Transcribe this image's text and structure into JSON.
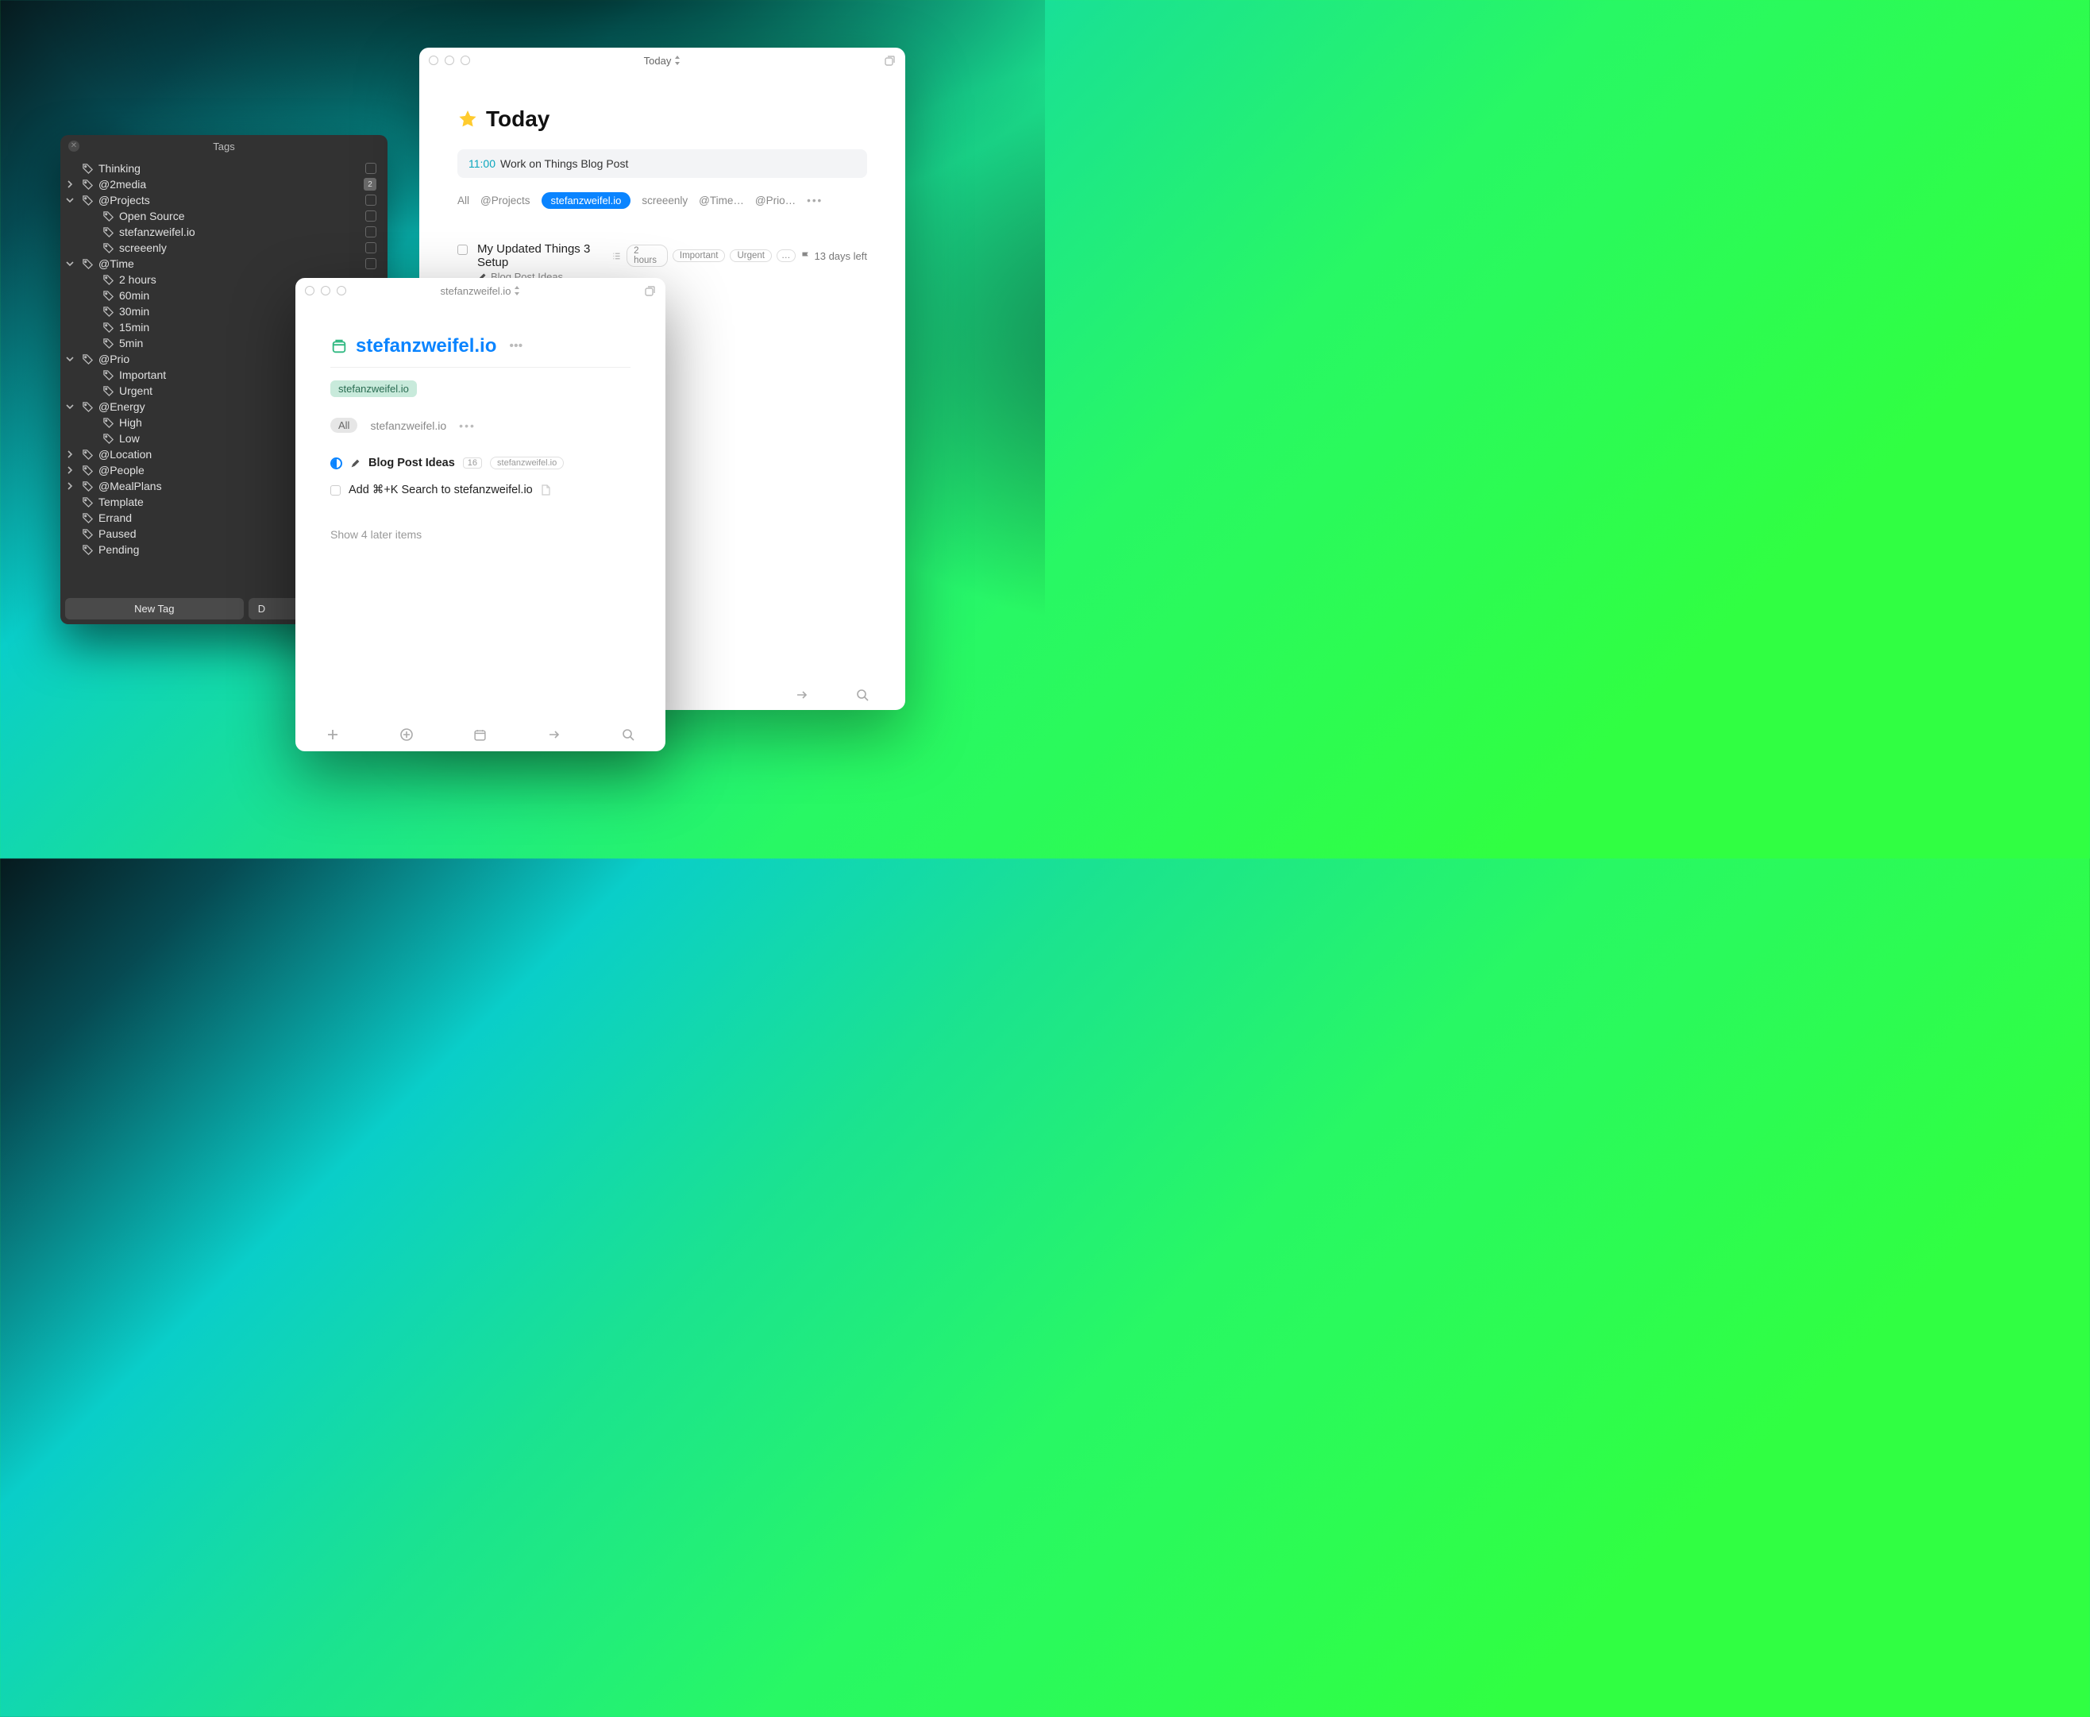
{
  "tags_window": {
    "title": "Tags",
    "new_tag_button": "New Tag",
    "delete_button_visible_text": "D",
    "items": [
      {
        "label": "Thinking",
        "level": 0,
        "chevron": "",
        "right": "checkbox"
      },
      {
        "label": "@2media",
        "level": 0,
        "chevron": "right",
        "right": "count",
        "count": "2"
      },
      {
        "label": "@Projects",
        "level": 0,
        "chevron": "down",
        "right": "checkbox"
      },
      {
        "label": "Open Source",
        "level": 1,
        "chevron": "",
        "right": "checkbox"
      },
      {
        "label": "stefanzweifel.io",
        "level": 1,
        "chevron": "",
        "right": "checkbox"
      },
      {
        "label": "screeenly",
        "level": 1,
        "chevron": "",
        "right": "checkbox"
      },
      {
        "label": "@Time",
        "level": 0,
        "chevron": "down",
        "right": "checkbox"
      },
      {
        "label": "2 hours",
        "level": 1,
        "chevron": "",
        "right": ""
      },
      {
        "label": "60min",
        "level": 1,
        "chevron": "",
        "right": ""
      },
      {
        "label": "30min",
        "level": 1,
        "chevron": "",
        "right": ""
      },
      {
        "label": "15min",
        "level": 1,
        "chevron": "",
        "right": ""
      },
      {
        "label": "5min",
        "level": 1,
        "chevron": "",
        "right": ""
      },
      {
        "label": "@Prio",
        "level": 0,
        "chevron": "down",
        "right": ""
      },
      {
        "label": "Important",
        "level": 1,
        "chevron": "",
        "right": ""
      },
      {
        "label": "Urgent",
        "level": 1,
        "chevron": "",
        "right": ""
      },
      {
        "label": "@Energy",
        "level": 0,
        "chevron": "down",
        "right": ""
      },
      {
        "label": "High",
        "level": 1,
        "chevron": "",
        "right": ""
      },
      {
        "label": "Low",
        "level": 1,
        "chevron": "",
        "right": ""
      },
      {
        "label": "@Location",
        "level": 0,
        "chevron": "right",
        "right": ""
      },
      {
        "label": "@People",
        "level": 0,
        "chevron": "right",
        "right": ""
      },
      {
        "label": "@MealPlans",
        "level": 0,
        "chevron": "right",
        "right": ""
      },
      {
        "label": "Template",
        "level": 0,
        "chevron": "",
        "right": ""
      },
      {
        "label": "Errand",
        "level": 0,
        "chevron": "",
        "right": ""
      },
      {
        "label": "Paused",
        "level": 0,
        "chevron": "",
        "right": ""
      },
      {
        "label": "Pending",
        "level": 0,
        "chevron": "",
        "right": ""
      }
    ]
  },
  "today_window": {
    "titlebar_label": "Today",
    "heading": "Today",
    "event_time": "11:00",
    "event_title": "Work on Things Blog Post",
    "filters": {
      "all": "All",
      "projects": "@Projects",
      "active_pill": "stefanzweifel.io",
      "screeenly": "screeenly",
      "time": "@Time…",
      "prio": "@Prio…"
    },
    "task": {
      "title": "My Updated Things 3 Setup",
      "project": "Blog Post Ideas",
      "tags": [
        "2 hours",
        "Important",
        "Urgent"
      ],
      "deadline": "13 days left"
    }
  },
  "project_window": {
    "titlebar_label": "stefanzweifel.io",
    "heading": "stefanzweifel.io",
    "area_tag": "stefanzweifel.io",
    "filters": {
      "all": "All",
      "tag": "stefanzweifel.io"
    },
    "row1": {
      "title": "Blog Post Ideas",
      "count": "16",
      "tag": "stefanzweifel.io"
    },
    "row2": {
      "title": "Add ⌘+K Search to stefanzweifel.io"
    },
    "show_later": "Show 4 later items"
  }
}
